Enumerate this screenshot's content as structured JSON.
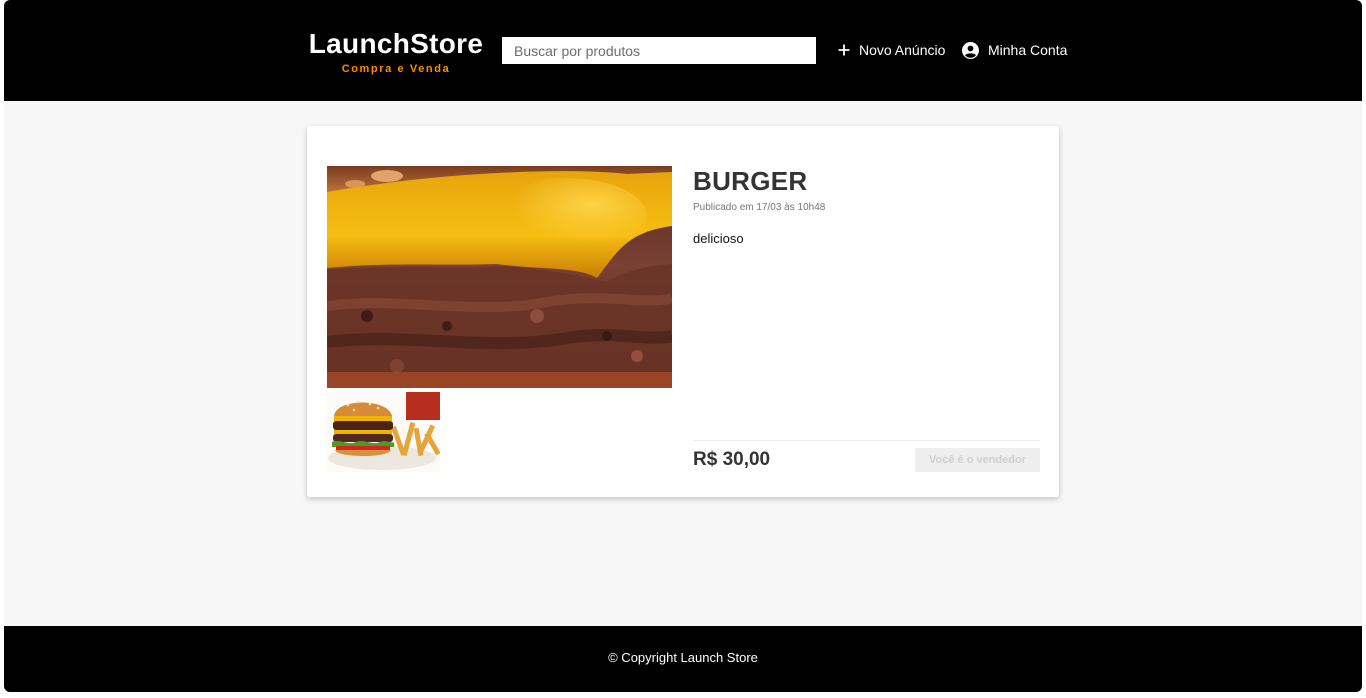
{
  "header": {
    "logo_title": "LaunchStore",
    "logo_subtitle": "Compra e Venda",
    "subtitle_color": "#ff8a00",
    "search_placeholder": "Buscar por produtos",
    "new_ad_label": "Novo Anúncio",
    "new_ad_icon": "plus-icon",
    "account_label": "Minha Conta",
    "account_icon": "account-circle-icon"
  },
  "product": {
    "title": "BURGER",
    "published": "Publicado em 17/03 às 10h48",
    "description": "delicioso",
    "price": "R$ 30,00",
    "seller_button": "Você é o vendedor",
    "main_photo": "burger-closeup-photo",
    "thumbnails": [
      "burger-with-fries-photo"
    ]
  },
  "footer": {
    "copyright": "© Copyright Launch Store"
  }
}
